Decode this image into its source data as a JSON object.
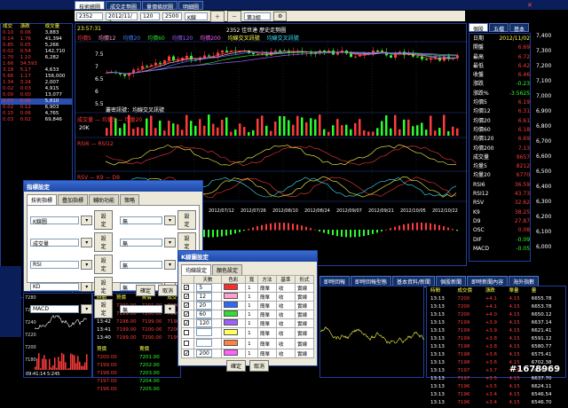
{
  "top_tabs": [
    "技術繪圖",
    "成交走勢圖",
    "量價條狀圖",
    "明細圖"
  ],
  "toolbar": {
    "code": "2352",
    "date": "2012/11/ 2",
    "value1": "120",
    "value2": "2500",
    "mode": "K線",
    "view": "第3組"
  },
  "chart": {
    "time": "23:57:31",
    "title": "2352 佳世達 歷史走勢圖",
    "legend": [
      "均價5",
      "均價12",
      "均價20",
      "均價60",
      "均價120",
      "均價200",
      "均線交叉訊號",
      "均線交叉訊號"
    ],
    "price_ticks": [
      "7.5",
      "7",
      "6.5",
      "6",
      "5.5"
    ],
    "signal_note": "叢密訊號：均線交叉訊號",
    "vol_label": "成交量 — 均量5 — 均量20",
    "vol_tick": "20K",
    "rsi_label": "RSI6 — RSI12",
    "kd_label": "RSV — K9 — D9",
    "dates": [
      "2012/07/12",
      "2012/07/26",
      "2012/08/10",
      "2012/08/24",
      "2012/09/07",
      "2012/09/21",
      "2012/10/05",
      "2012/10/22"
    ]
  },
  "left_table": {
    "header": [
      "成交",
      "漲跌",
      "成交量"
    ],
    "rows": [
      [
        "0.10",
        "0.06",
        "3,883"
      ],
      [
        "0.14",
        "1.76",
        "41,394"
      ],
      [
        "0.85",
        "0.05",
        "5,266"
      ],
      [
        "0.02",
        "0.54",
        "142,710"
      ],
      [
        "1.70",
        "1.10",
        "6,282"
      ],
      [
        "1.66",
        "34,593"
      ],
      [
        "3.18",
        "5.17",
        "4,633"
      ],
      [
        "5.66",
        "1.17",
        "156,000"
      ],
      [
        "1.34",
        "3.24",
        "2,007"
      ],
      [
        "0.02",
        "0.03",
        "4,915"
      ],
      [
        "0.00",
        "0.00",
        "13,077"
      ],
      [
        "0.07",
        "0.06",
        "5,810"
      ],
      [
        "0.02",
        "0.12",
        "6,903"
      ],
      [
        "0.15",
        "0.06",
        "4,765"
      ],
      [
        "0.03",
        "0.02",
        "69,846"
      ]
    ]
  },
  "right_panel": {
    "tabs": [
      "個股",
      "五檔",
      "基本"
    ],
    "rows": [
      [
        "日期",
        "2012/11/02"
      ],
      [
        "開盤",
        "6.69"
      ],
      [
        "最高",
        "6.72"
      ],
      [
        "最低",
        "6.42"
      ],
      [
        "收盤",
        "6.46"
      ],
      [
        "漲跌",
        "-0.23"
      ],
      [
        "漲跌%",
        "-3.5625"
      ],
      [
        "均價5",
        "6.19"
      ],
      [
        "均價12",
        "6.31"
      ],
      [
        "均價20",
        "6.61"
      ],
      [
        "均價60",
        "6.18"
      ],
      [
        "均價120",
        "6.69"
      ],
      [
        "均價200",
        "7.13"
      ],
      [
        "成交量",
        "9657"
      ],
      [
        "均量5",
        "8212"
      ],
      [
        "均量20",
        "6770"
      ],
      [
        "RSI6",
        "36.59"
      ],
      [
        "RSI12",
        "43.73"
      ],
      [
        "RSV",
        "32.62"
      ],
      [
        "K9",
        "38.25"
      ],
      [
        "D9",
        "27.87"
      ],
      [
        "OSC",
        "0.08"
      ],
      [
        "DIF",
        "-0.09"
      ],
      [
        "MACD",
        "-0.05"
      ]
    ],
    "axis": [
      "7,400",
      "7,300",
      "7,200",
      "7,100",
      "7,000",
      "6,900",
      "6,800",
      "6,700",
      "6,600",
      "6,500",
      "6,400",
      "6,300",
      "6,200",
      "6,100",
      "6,000"
    ]
  },
  "dialog1": {
    "title": "指標設定",
    "tabs": [
      "技術指標",
      "疊加指標",
      "輔助功能",
      "策略"
    ],
    "rows": [
      {
        "ind": "K線圖",
        "set": "設定",
        "opt": "無",
        "set2": "設定"
      },
      {
        "ind": "成交量",
        "set": "設定",
        "opt": "無",
        "set2": "設定"
      },
      {
        "ind": "RSI",
        "set": "設定",
        "opt": "無",
        "set2": "設定"
      },
      {
        "ind": "KD",
        "set": "設定",
        "opt": "無",
        "set2": "設定"
      },
      {
        "ind": "MACD",
        "set": "設定",
        "opt": "無",
        "set2": "設定"
      }
    ],
    "ok": "確定",
    "cancel": "取消",
    "apply": "套用"
  },
  "dialog2": {
    "title": "K線圖設定",
    "tabs": [
      "均線設定",
      "顏色設定"
    ],
    "header": [
      "",
      "天數",
      "色彩",
      "寬",
      "方法",
      "基準",
      "形式"
    ],
    "rows": [
      {
        "chk": "✓",
        "days": "5",
        "color": "#ff2a2a",
        "w": "1",
        "method": "簡單",
        "base": "收",
        "shape": "實線"
      },
      {
        "chk": "✓",
        "days": "12",
        "color": "#ffa0d0",
        "w": "1",
        "method": "簡單",
        "base": "收",
        "shape": "實線"
      },
      {
        "chk": "✓",
        "days": "20",
        "color": "#2a6aff",
        "w": "1",
        "method": "簡單",
        "base": "收",
        "shape": "實線"
      },
      {
        "chk": "✓",
        "days": "60",
        "color": "#30e030",
        "w": "1",
        "method": "簡單",
        "base": "收",
        "shape": "實線"
      },
      {
        "chk": "✓",
        "days": "120",
        "color": "#a060ff",
        "w": "1",
        "method": "簡單",
        "base": "收",
        "shape": "實線"
      },
      {
        "chk": "",
        "days": "",
        "color": "#ffff60",
        "w": "1",
        "method": "簡單",
        "base": "收",
        "shape": "實線"
      },
      {
        "chk": "",
        "days": "",
        "color": "#ff8040",
        "w": "1",
        "method": "簡單",
        "base": "收",
        "shape": "實線"
      },
      {
        "chk": "✓",
        "days": "200",
        "color": "#ff60ff",
        "w": "1",
        "method": "簡單",
        "base": "收",
        "shape": "實線"
      }
    ],
    "ok": "確定",
    "cancel": "取消"
  },
  "bottom_tabs": [
    "即時回報",
    "即時回報型態",
    "基本資料/新聞",
    "個股新聞",
    "即時新聞內容",
    "海外指數"
  ],
  "quote_left": {
    "header": [
      "時間",
      "買價",
      "賣價",
      "成交"
    ],
    "rows": [
      [
        "13:44",
        "7200.00",
        "7201.00",
        "7200.00"
      ],
      [
        "13:43",
        "7199.00",
        "7200.00",
        "7199.00"
      ],
      [
        "13:42",
        "7198.00",
        "7199.00",
        "7198.00"
      ],
      [
        "13:41",
        "7199.00",
        "7200.00",
        "7200.00"
      ],
      [
        "13:40",
        "7199.00",
        "7200.00",
        "7199.00"
      ]
    ],
    "book": [
      [
        "7200.00",
        "7201.00"
      ],
      [
        "7199.00",
        "7202.00"
      ],
      [
        "7198.00",
        "7203.00"
      ],
      [
        "7197.00",
        "7204.00"
      ],
      [
        "7196.00",
        "7205.00"
      ]
    ],
    "book_header": [
      "買價",
      "賣價"
    ],
    "time_label": "09:41:14 5:245",
    "axis": [
      "7280",
      "7260",
      "7240",
      "7220",
      "7200",
      "7180"
    ]
  },
  "quote_right": {
    "header": [
      "時間",
      "成交價",
      "漲跌",
      "單量",
      "量"
    ],
    "rows": [
      [
        "13:13",
        "7200",
        "+4.1",
        "4.15",
        "6655.78"
      ],
      [
        "13:13",
        "7200",
        "+4.1",
        "4.15",
        "6653.78"
      ],
      [
        "13:13",
        "7200",
        "+4.0",
        "4.15",
        "6650.12"
      ],
      [
        "13:13",
        "7199",
        "+3.9",
        "4.15",
        "6637.14"
      ],
      [
        "13:13",
        "7199",
        "+3.9",
        "4.15",
        "6621.41"
      ],
      [
        "13:13",
        "7199",
        "+3.8",
        "4.15",
        "6591.12"
      ],
      [
        "13:13",
        "7198",
        "+3.8",
        "4.15",
        "6580.77"
      ],
      [
        "13:13",
        "7198",
        "+3.6",
        "4.15",
        "6575.41"
      ],
      [
        "13:13",
        "7198",
        "+3.6",
        "4.15",
        "6702.38"
      ],
      [
        "13:13",
        "7197",
        "+3.7",
        "4.15",
        "6656.60"
      ],
      [
        "13:13",
        "7197",
        "+3.5",
        "4.15",
        "6637.70"
      ],
      [
        "13:13",
        "7196",
        "+3.5",
        "4.15",
        "6624.11"
      ],
      [
        "13:13",
        "7196",
        "+3.4",
        "4.15",
        "6546.54"
      ],
      [
        "13:13",
        "7196",
        "+3.4",
        "4.15",
        "6546.70"
      ]
    ]
  },
  "watermark": "#1678969",
  "colors": {
    "up": "#ff3b3b",
    "down": "#2bff2b",
    "frame": "#1c47a8"
  }
}
